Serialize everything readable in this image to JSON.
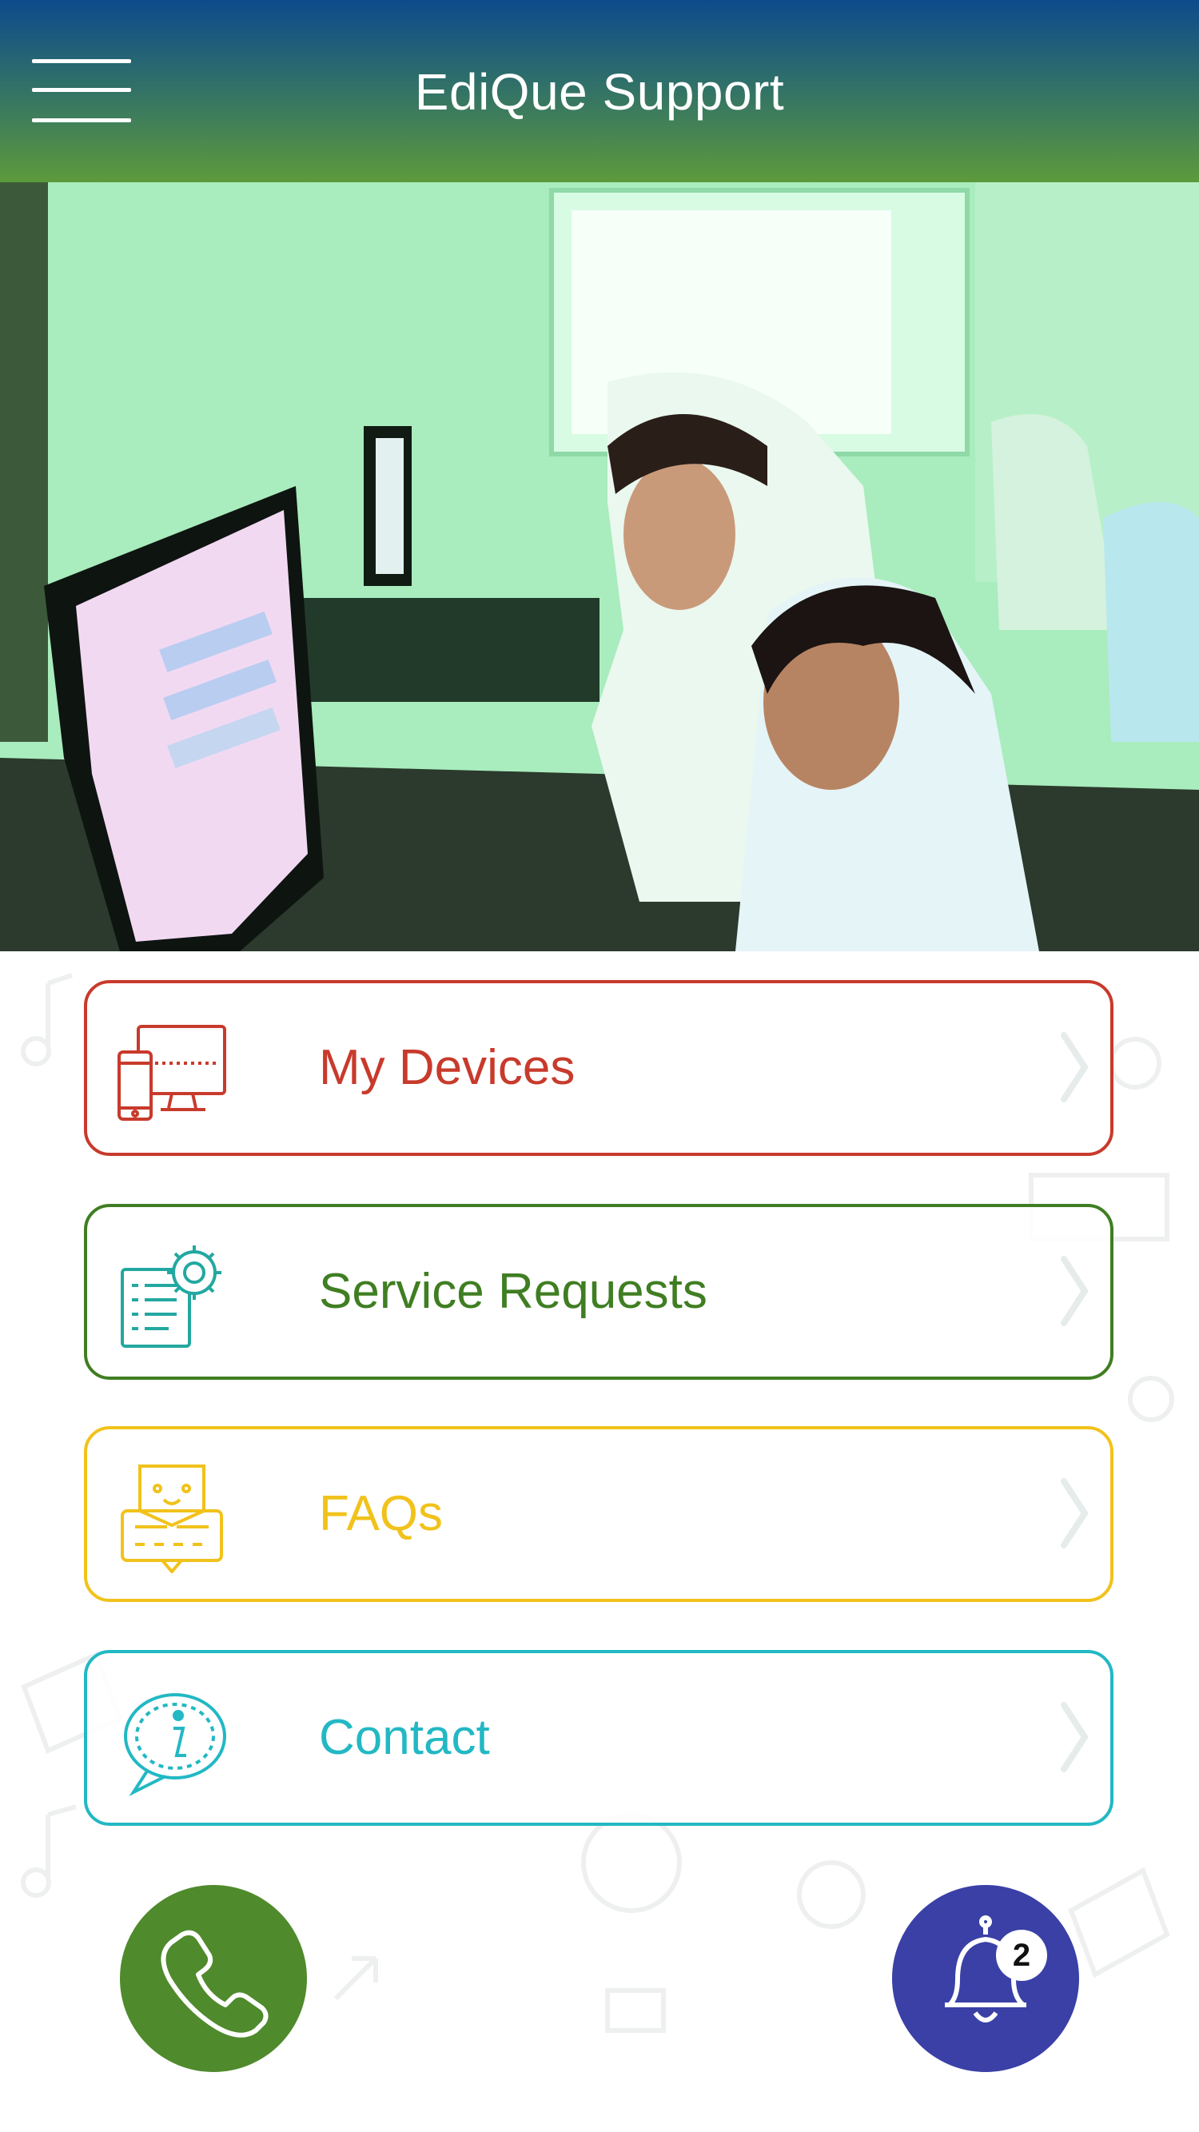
{
  "header": {
    "title": "EdiQue Support",
    "menu_icon": "hamburger-icon"
  },
  "hero": {
    "kind": "photo"
  },
  "menu": [
    {
      "label": "My Devices",
      "icon": "devices-icon",
      "color": "#c83a2c"
    },
    {
      "label": "Service Requests",
      "icon": "service-gear-icon",
      "color": "#3f7e22"
    },
    {
      "label": "FAQs",
      "icon": "faq-chat-icon",
      "color": "#f1c21b"
    },
    {
      "label": "Contact",
      "icon": "info-bubble-icon",
      "color": "#22b8c4"
    }
  ],
  "actions": {
    "call_icon": "phone-icon",
    "call_color": "#4f8a2c",
    "notifications_icon": "bell-icon",
    "notifications_color": "#3a40a6",
    "notification_count": "2"
  }
}
